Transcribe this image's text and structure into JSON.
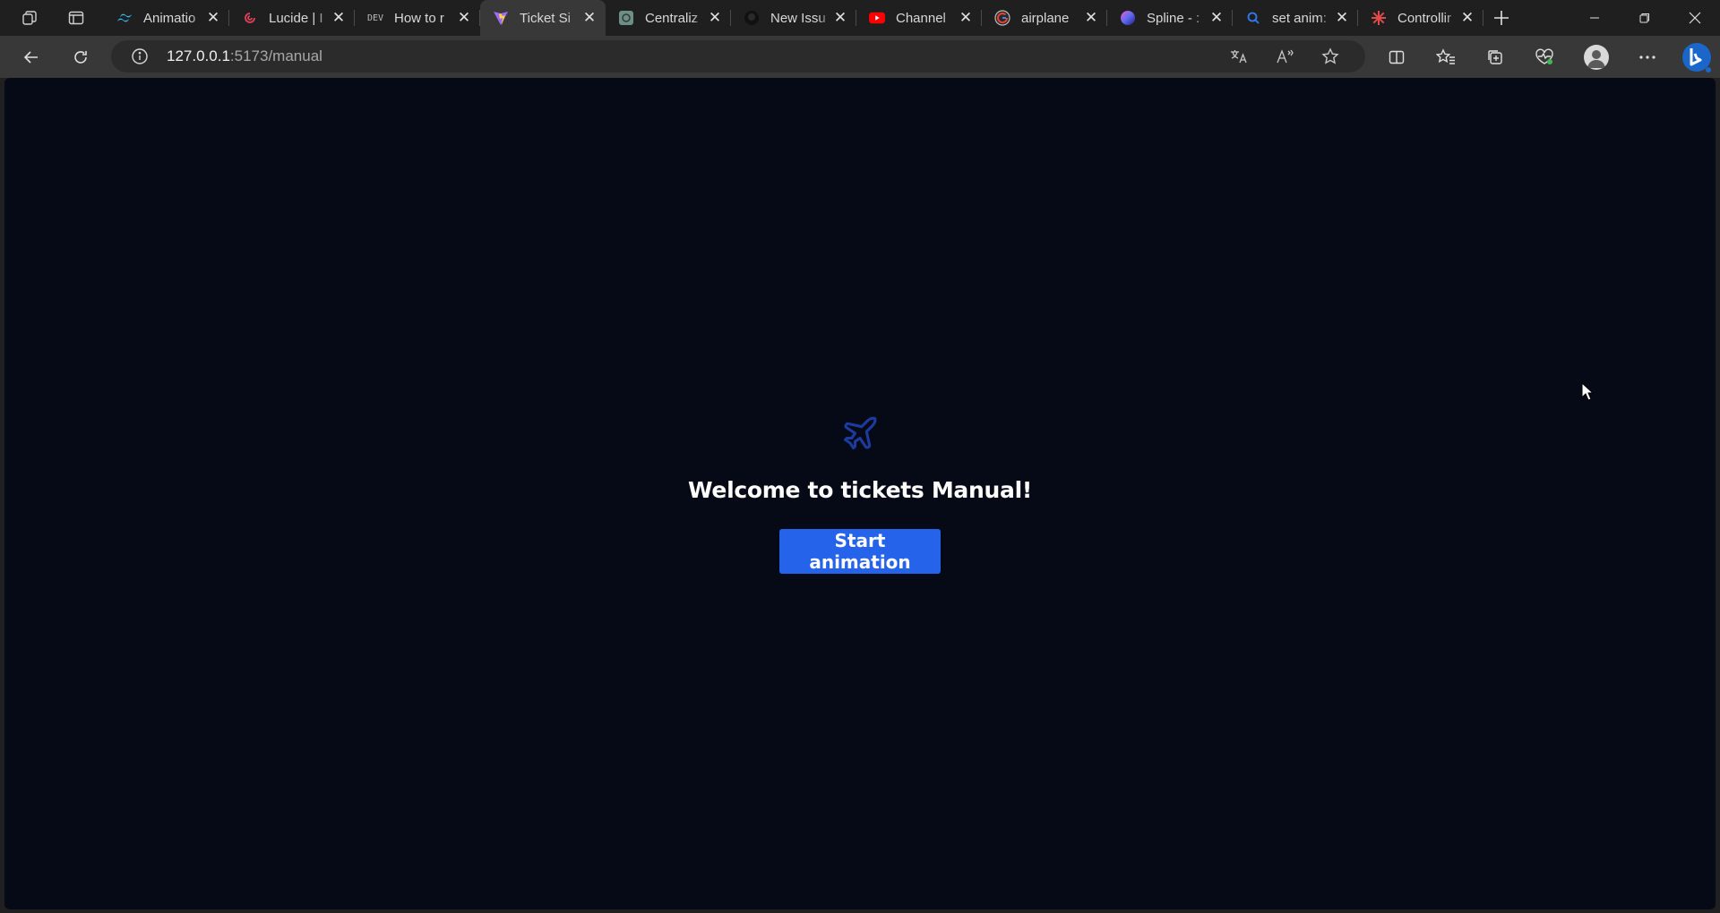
{
  "browser": {
    "tabs": [
      {
        "title": "Animatio",
        "favicon": "tailwind-icon"
      },
      {
        "title": "Lucide | I",
        "favicon": "lucide-icon"
      },
      {
        "title": "How to r",
        "favicon": "dev-icon",
        "favicon_text": "DEV"
      },
      {
        "title": "Ticket Si",
        "favicon": "vite-icon",
        "active": true
      },
      {
        "title": "Centraliz",
        "favicon": "openai-icon"
      },
      {
        "title": "New Issu",
        "favicon": "github-icon"
      },
      {
        "title": "Channel",
        "favicon": "youtube-icon"
      },
      {
        "title": "airplane",
        "favicon": "google-icon"
      },
      {
        "title": "Spline - :",
        "favicon": "spline-icon"
      },
      {
        "title": "set anim:",
        "favicon": "search-icon"
      },
      {
        "title": "Controllir",
        "favicon": "asterisk-icon"
      }
    ],
    "url": {
      "host": "127.0.0.1",
      "path": ":5173/manual"
    }
  },
  "page": {
    "title": "Welcome to tickets Manual!",
    "button_label": "Start animation",
    "icon": "plane-icon",
    "colors": {
      "background": "#050a16",
      "accent": "#2563eb",
      "icon": "#1d3a9e"
    }
  }
}
